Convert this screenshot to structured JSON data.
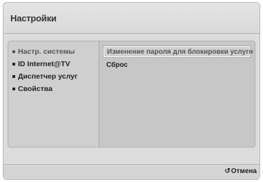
{
  "header": {
    "title": "Настройки"
  },
  "menu": {
    "items": [
      {
        "label": "Настр. системы",
        "icon": "bullet-icon",
        "active": true
      },
      {
        "label": "ID Internet@TV",
        "icon": "bullet-icon",
        "active": false
      },
      {
        "label": "Диспетчер услуг",
        "icon": "bullet-icon",
        "active": false
      },
      {
        "label": "Свойства",
        "icon": "bullet-icon",
        "active": false
      }
    ]
  },
  "options": {
    "change_password": "Изменение пароля для блокировки услуги",
    "reset": "Сброс"
  },
  "footer": {
    "return_icon": "return-icon",
    "cancel_label": "Отмена"
  },
  "colors": {
    "background": "#dcdcdc",
    "panel": "#c9c9c9",
    "focus_border": "#ffffff",
    "text": "#222222"
  }
}
